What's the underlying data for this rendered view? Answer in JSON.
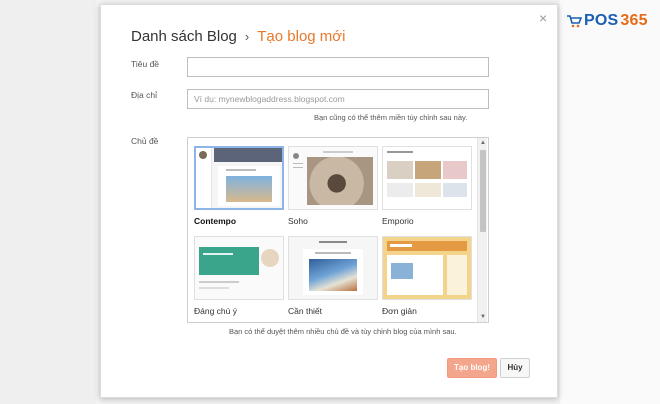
{
  "brand": {
    "part1": "POS",
    "part2": "365"
  },
  "dialog": {
    "breadcrumb_root": "Danh sách Blog",
    "breadcrumb_separator": "›",
    "breadcrumb_current": "Tạo blog mới",
    "close_label": "×"
  },
  "form": {
    "title_label": "Tiêu đề",
    "title_value": "",
    "address_label": "Địa chỉ",
    "address_placeholder": "Ví dụ: mynewblogaddress.blogspot.com",
    "address_hint": "Bạn cũng có thể thêm miền tùy chỉnh sau này.",
    "theme_label": "Chủ đề",
    "theme_hint": "Bạn có thể duyệt thêm nhiều chủ đề và tùy chỉnh blog của mình sau."
  },
  "themes": [
    {
      "name": "Contempo",
      "selected": true
    },
    {
      "name": "Soho",
      "selected": false
    },
    {
      "name": "Emporio",
      "selected": false
    },
    {
      "name": "Đáng chú ý",
      "selected": false
    },
    {
      "name": "Cần thiết",
      "selected": false
    },
    {
      "name": "Đơn giản",
      "selected": false
    }
  ],
  "buttons": {
    "create": "Tạo blog!",
    "cancel": "Hủy"
  },
  "colors": {
    "accent": "#e8782a",
    "primary_button": "#f4a68c",
    "selected_border": "#8fb4e8"
  }
}
